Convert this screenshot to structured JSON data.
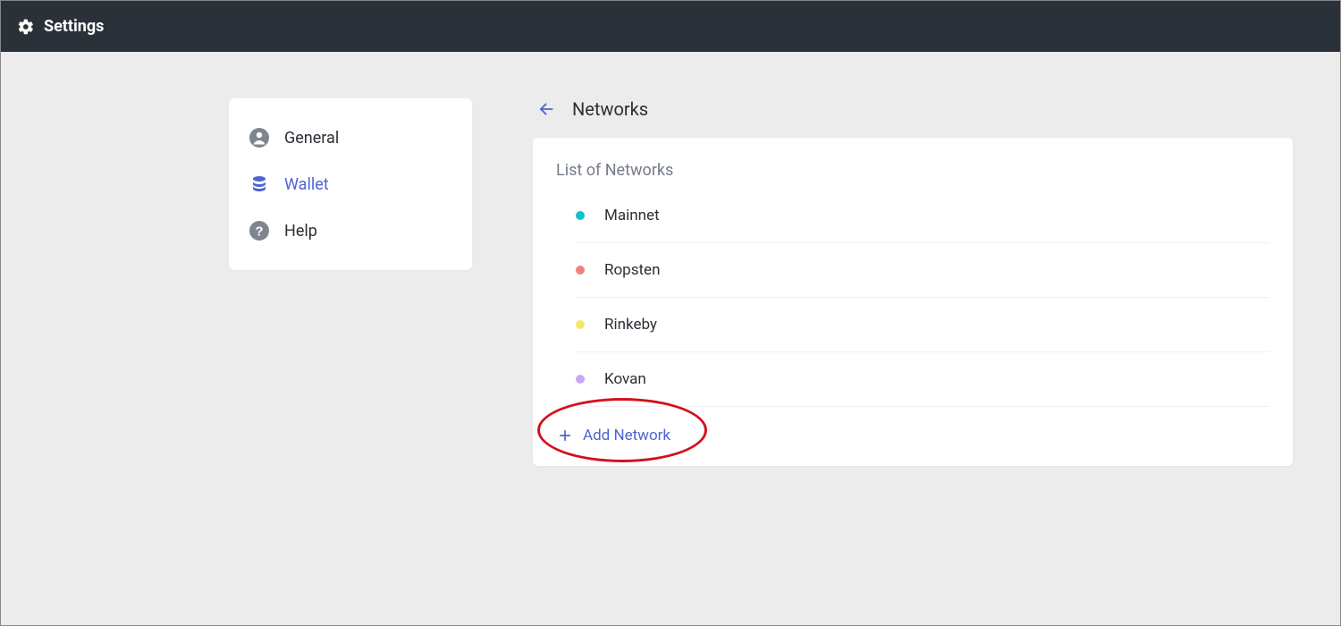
{
  "topbar": {
    "title": "Settings"
  },
  "sidebar": {
    "items": [
      {
        "label": "General",
        "icon": "person-icon",
        "active": false
      },
      {
        "label": "Wallet",
        "icon": "stack-icon",
        "active": true
      },
      {
        "label": "Help",
        "icon": "help-icon",
        "active": false
      }
    ]
  },
  "main": {
    "title": "Networks",
    "list_title": "List of Networks",
    "networks": [
      {
        "name": "Mainnet",
        "color": "#14c0c9"
      },
      {
        "name": "Ropsten",
        "color": "#f08080"
      },
      {
        "name": "Rinkeby",
        "color": "#f4e66a"
      },
      {
        "name": "Kovan",
        "color": "#c9a8f2"
      }
    ],
    "add_label": "Add Network"
  }
}
